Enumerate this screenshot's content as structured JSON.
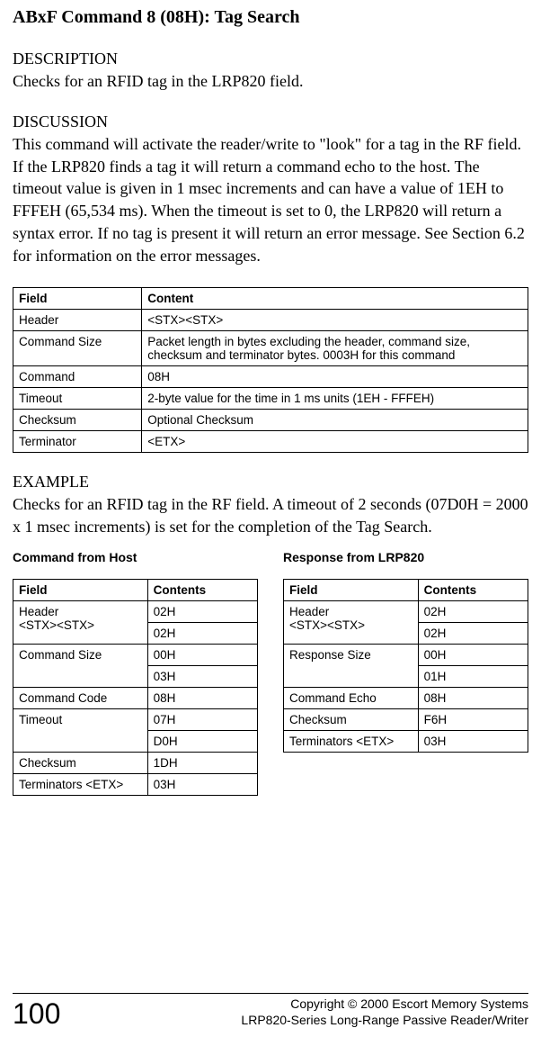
{
  "title": "ABxF Command 8 (08H): Tag Search",
  "description": {
    "label": "DESCRIPTION",
    "text": "Checks for an RFID tag in the LRP820 field."
  },
  "discussion": {
    "label": "DISCUSSION",
    "text": "This command will activate the reader/write to \"look\" for a tag in the RF field. If the LRP820 finds a tag it will return a command echo to the host. The timeout value is given in 1 msec increments and can have a value of 1EH to FFFEH (65,534 ms). When the timeout is set to 0, the LRP820 will return a syntax error. If no tag is present it will return an error message.  See Section 6.2 for information on the error messages."
  },
  "mainTable": {
    "headers": [
      "Field",
      "Content"
    ],
    "rows": [
      [
        "Header",
        "<STX><STX>"
      ],
      [
        "Command Size",
        "Packet length in bytes excluding the header, command size, checksum and terminator bytes.  0003H for this command"
      ],
      [
        "Command",
        "08H"
      ],
      [
        "Timeout",
        "2-byte value for the time in 1 ms units (1EH - FFFEH)"
      ],
      [
        "Checksum",
        "Optional Checksum"
      ],
      [
        "Terminator",
        "<ETX>"
      ]
    ]
  },
  "example": {
    "label": "EXAMPLE",
    "text": "Checks for an RFID tag in the RF field. A timeout of 2 seconds (07D0H = 2000 x 1 msec increments) is set for the completion of the Tag Search."
  },
  "commandFromHost": {
    "title": "Command from Host",
    "headers": [
      "Field",
      "Contents"
    ],
    "rows": [
      {
        "field": "Header\n<STX><STX>",
        "content": "02H",
        "rowspan": 2
      },
      {
        "content": "02H"
      },
      {
        "field": "Command Size",
        "content": "00H",
        "rowspan": 2
      },
      {
        "content": "03H"
      },
      {
        "field": "Command Code",
        "content": "08H"
      },
      {
        "field": "Timeout",
        "content": "07H",
        "rowspan": 2
      },
      {
        "content": "D0H"
      },
      {
        "field": "Checksum",
        "content": "1DH"
      },
      {
        "field": "Terminators <ETX>",
        "content": "03H"
      }
    ]
  },
  "responseFromLRP820": {
    "title": "Response from LRP820",
    "headers": [
      "Field",
      "Contents"
    ],
    "rows": [
      {
        "field": "Header\n<STX><STX>",
        "content": "02H",
        "rowspan": 2
      },
      {
        "content": "02H"
      },
      {
        "field": "Response Size",
        "content": "00H",
        "rowspan": 2
      },
      {
        "content": "01H"
      },
      {
        "field": "Command Echo",
        "content": "08H"
      },
      {
        "field": "Checksum",
        "content": "F6H"
      },
      {
        "field": "Terminators <ETX>",
        "content": "03H"
      }
    ]
  },
  "footer": {
    "pageNum": "100",
    "line1": "Copyright © 2000 Escort Memory Systems",
    "line2": "LRP820-Series Long-Range Passive Reader/Writer"
  }
}
